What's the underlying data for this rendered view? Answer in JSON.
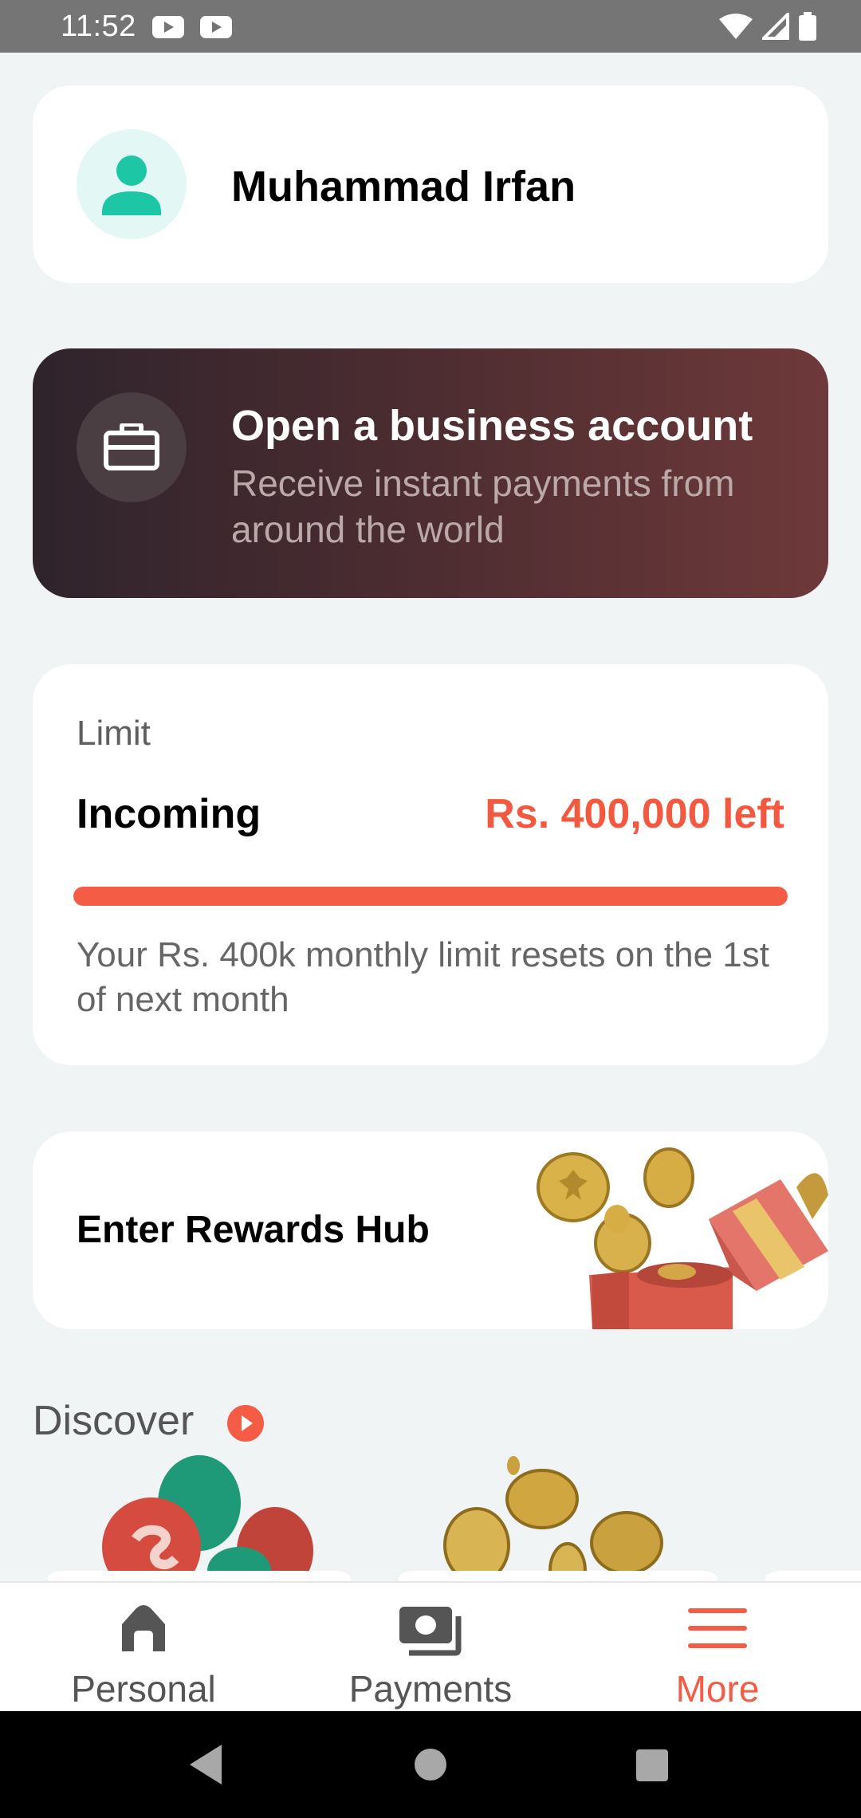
{
  "status_bar": {
    "time": "11:52"
  },
  "profile": {
    "name": "Muhammad Irfan"
  },
  "business": {
    "title": "Open a business account",
    "subtitle": "Receive instant payments from around the world"
  },
  "limit": {
    "label": "Limit",
    "type": "Incoming",
    "remaining": "Rs. 400,000 left",
    "progress_fraction": 1.0,
    "note": "Your Rs. 400k monthly limit resets on the 1st of next month"
  },
  "rewards": {
    "title": "Enter Rewards Hub"
  },
  "discover": {
    "title": "Discover"
  },
  "nav": {
    "items": [
      {
        "label": "Personal",
        "icon": "home-icon"
      },
      {
        "label": "Payments",
        "icon": "payments-icon"
      },
      {
        "label": "More",
        "icon": "menu-icon"
      }
    ]
  },
  "colors": {
    "accent": "#f45c45",
    "teal": "#1dc7a6",
    "background": "#f1f4f5"
  }
}
